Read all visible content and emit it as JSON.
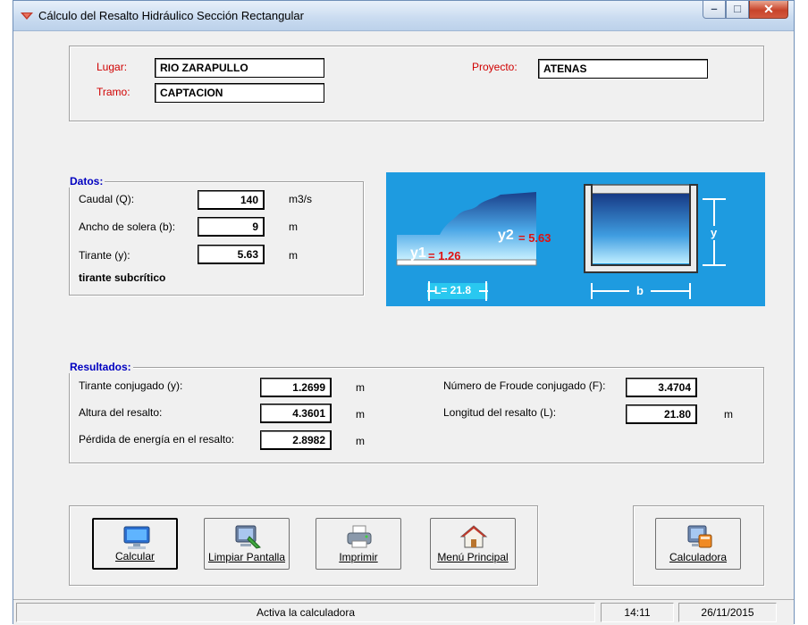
{
  "window": {
    "title": "Cálculo del Resalto Hidráulico Sección Rectangular",
    "minimize_glyph": "–",
    "maximize_glyph": "□",
    "close_glyph": "✕"
  },
  "header": {
    "lugar_label": "Lugar:",
    "lugar_value": "RIO ZARAPULLO",
    "tramo_label": "Tramo:",
    "tramo_value": "CAPTACION",
    "proyecto_label": "Proyecto:",
    "proyecto_value": "ATENAS"
  },
  "datos": {
    "legend": "Datos:",
    "caudal_label": "Caudal (Q):",
    "caudal_value": "140",
    "caudal_unit": "m3/s",
    "ancho_label": "Ancho de solera (b):",
    "ancho_value": "9",
    "ancho_unit": "m",
    "tirante_label": "Tirante (y):",
    "tirante_value": "5.63",
    "tirante_unit": "m",
    "status": "tirante subcrítico"
  },
  "diagram": {
    "y1_text": "y1",
    "y1_value": "= 1.26",
    "y2_text": "y2",
    "y2_value": "= 5.63",
    "l_text": "L= 21.8",
    "b_text": "b",
    "y_text": "y",
    "background_color": "#1e9be0"
  },
  "resultados": {
    "legend": "Resultados:",
    "conjugado_label": "Tirante conjugado (y):",
    "conjugado_value": "1.2699",
    "conjugado_unit": "m",
    "altura_label": "Altura del resalto:",
    "altura_value": "4.3601",
    "altura_unit": "m",
    "perdida_label": "Pérdida de energía en el resalto:",
    "perdida_value": "2.8982",
    "perdida_unit": "m",
    "froude_label": "Número de Froude conjugado (F):",
    "froude_value": "3.4704",
    "longitud_label": "Longitud del resalto (L):",
    "longitud_value": "21.80",
    "longitud_unit": "m"
  },
  "buttons": {
    "calcular": "Calcular",
    "limpiar": "Limpiar Pantalla",
    "imprimir": "Imprimir",
    "menu": "Menú Principal",
    "calculadora": "Calculadora"
  },
  "status": {
    "message": "Activa la calculadora",
    "time": "14:11",
    "date": "26/11/2015"
  }
}
